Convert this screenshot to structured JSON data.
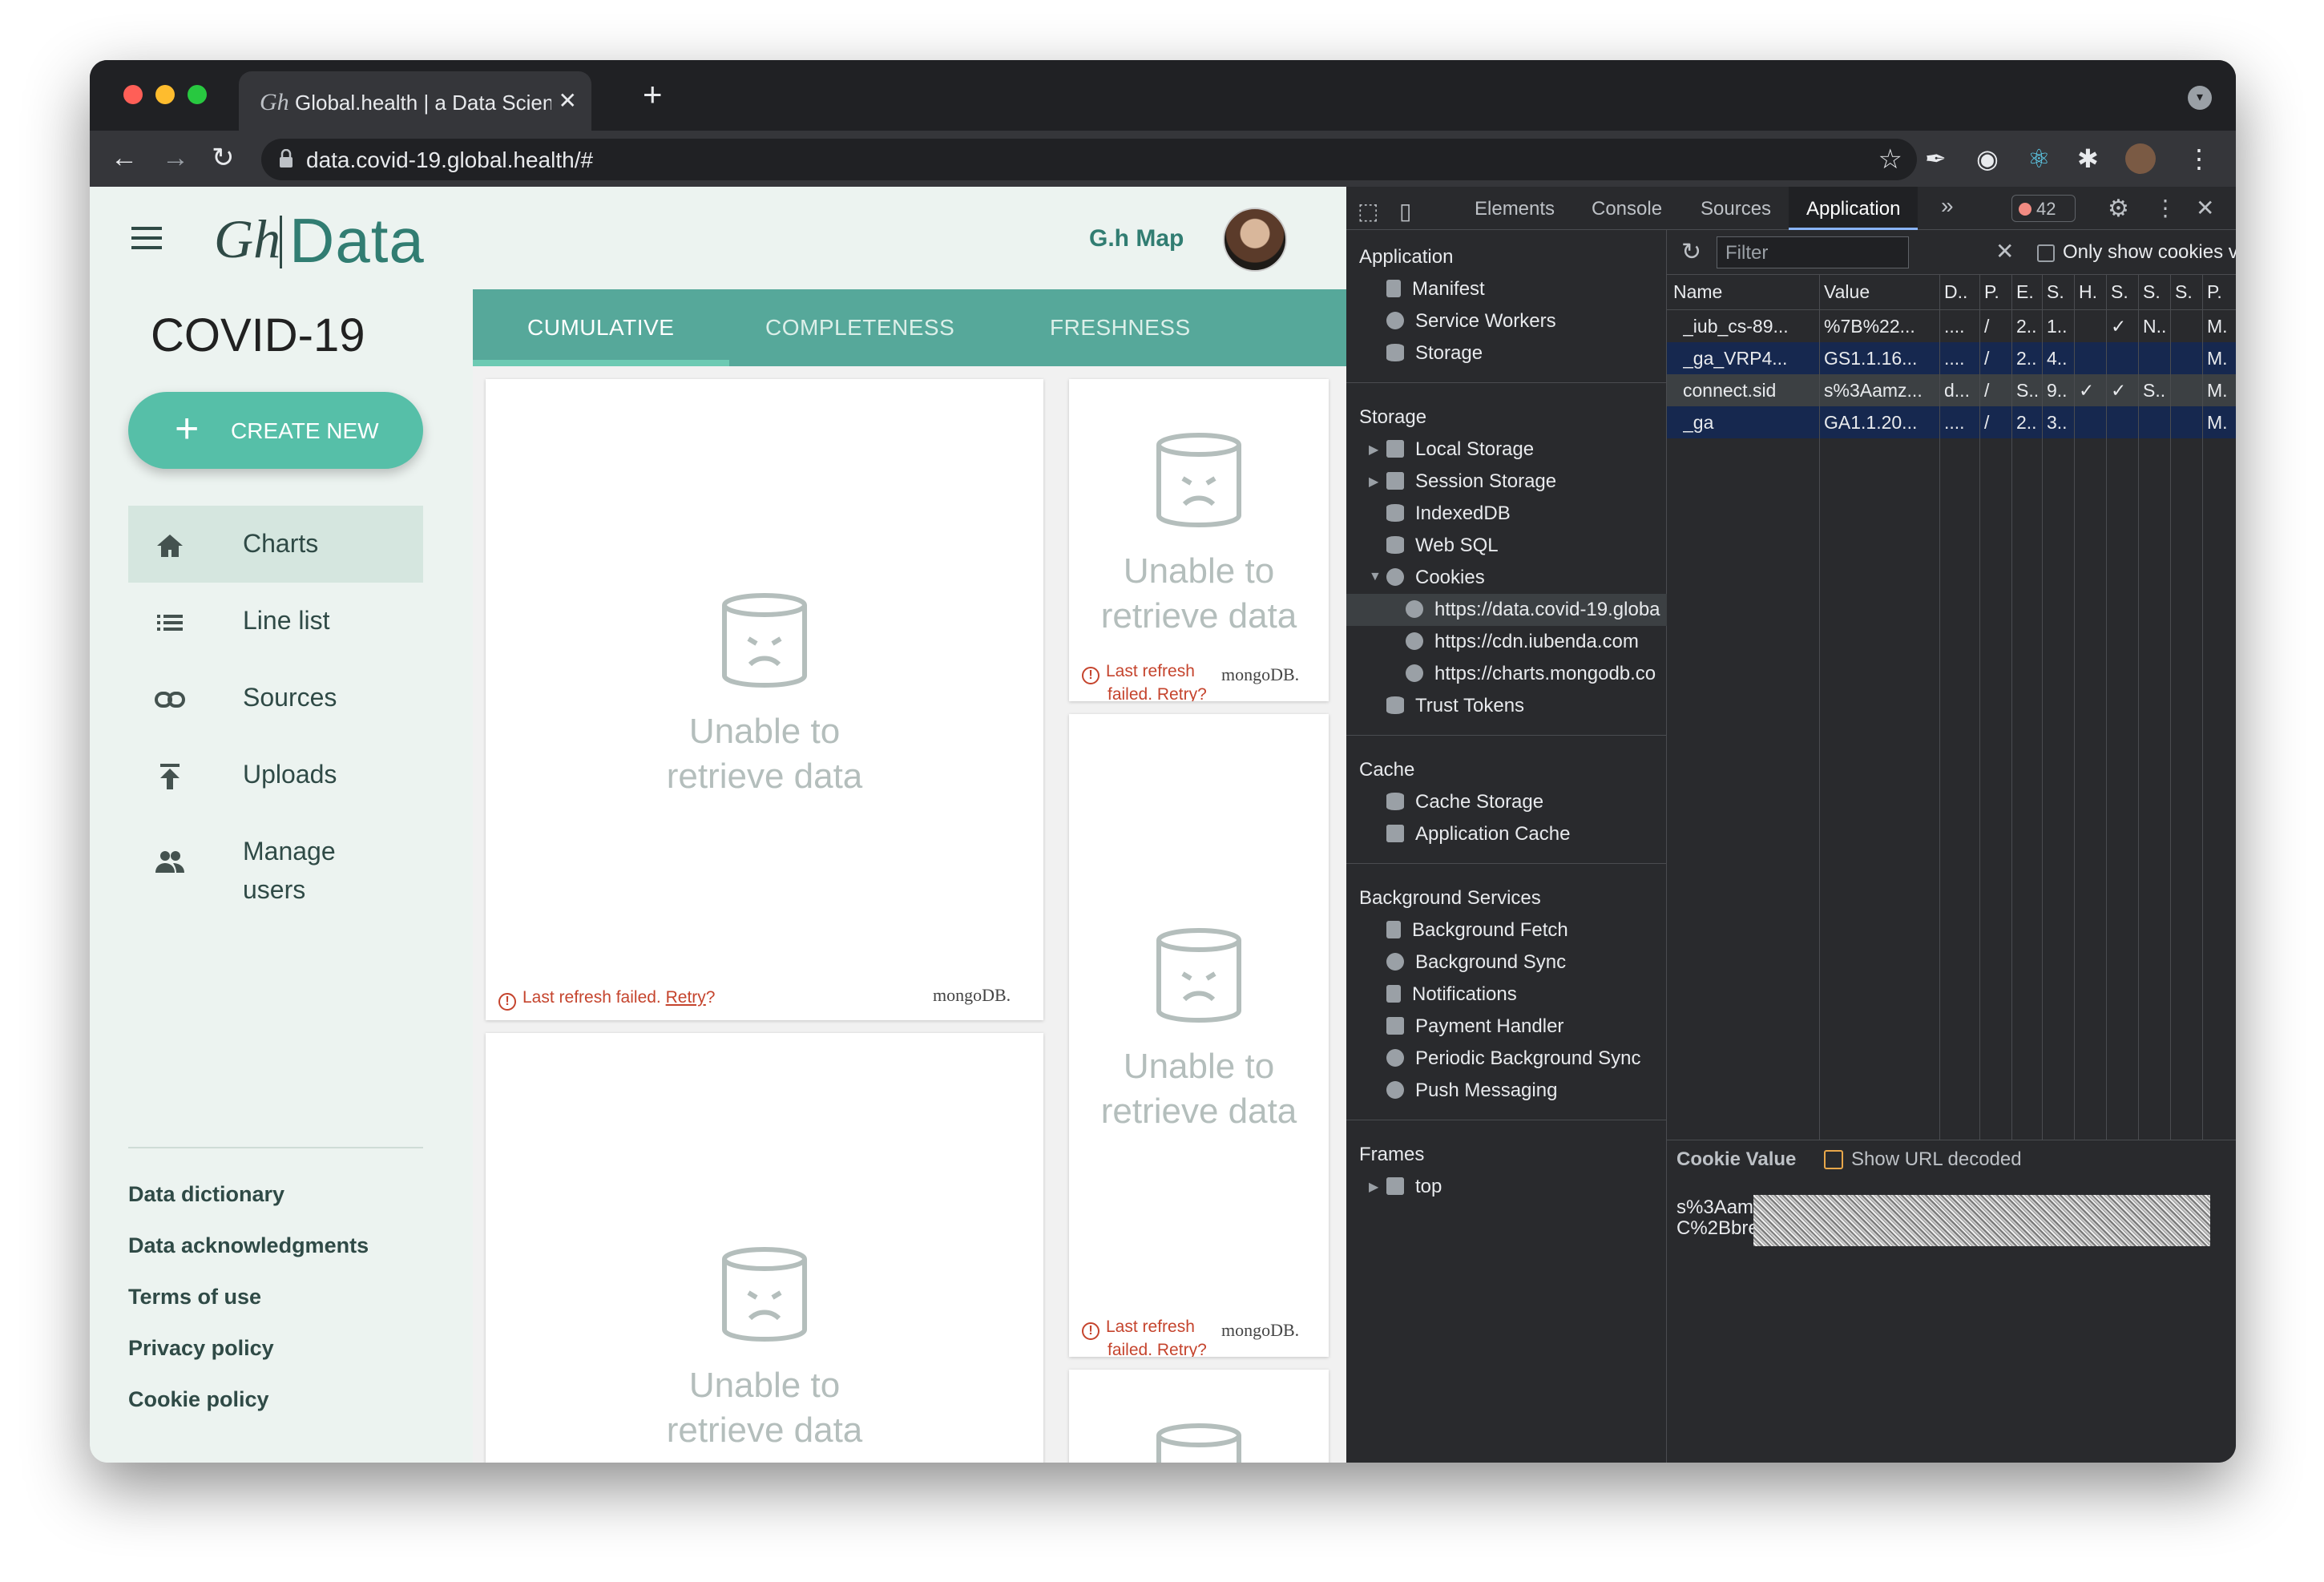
{
  "browser": {
    "tab_title": "Global.health | a Data Science I",
    "tab_logo": "Gh",
    "close_glyph": "✕",
    "new_tab_glyph": "+",
    "url": "data.covid-19.global.health/#",
    "icons": [
      "back-arrow-icon",
      "forward-arrow-icon",
      "reload-icon",
      "lock-icon",
      "star-icon",
      "puzzle-icon",
      "kebab-menu-icon"
    ]
  },
  "app": {
    "logo_gh": "Gh",
    "logo_text": "Data",
    "map_link": "G.h Map",
    "title": "COVID-19",
    "create_label": "CREATE NEW",
    "create_plus": "+",
    "nav": [
      {
        "label": "Charts",
        "icon": "home-icon",
        "active": true
      },
      {
        "label": "Line list",
        "icon": "list-icon"
      },
      {
        "label": "Sources",
        "icon": "link-icon"
      },
      {
        "label": "Uploads",
        "icon": "upload-icon"
      },
      {
        "label": "Manage",
        "label2": "users",
        "icon": "people-icon"
      }
    ],
    "footer_links": [
      "Data dictionary",
      "Data acknowledgments",
      "Terms of use",
      "Privacy policy",
      "Cookie policy"
    ],
    "chart_tabs": [
      "CUMULATIVE",
      "COMPLETENESS",
      "FRESHNESS"
    ],
    "active_tab": "CUMULATIVE",
    "card_error_line1": "Unable to",
    "card_error_line2": "retrieve data",
    "refresh_msg": "Last refresh failed.",
    "refresh_msg_a": "Last refresh",
    "refresh_msg_b": "failed.",
    "retry": "Retry",
    "retry_q": "?",
    "warn_glyph": "!",
    "brand": "mongoDB."
  },
  "devtools": {
    "tabs": [
      "Elements",
      "Console",
      "Sources",
      "Application"
    ],
    "active_tab": "Application",
    "more_glyph": "»",
    "error_count": "42",
    "sections": {
      "application": {
        "title": "Application",
        "items": [
          "Manifest",
          "Service Workers",
          "Storage"
        ]
      },
      "storage": {
        "title": "Storage",
        "items": [
          "Local Storage",
          "Session Storage",
          "IndexedDB",
          "Web SQL",
          "Cookies"
        ],
        "cookie_domains": [
          "https://data.covid-19.globa",
          "https://cdn.iubenda.com",
          "https://charts.mongodb.co"
        ],
        "after": "Trust Tokens"
      },
      "cache": {
        "title": "Cache",
        "items": [
          "Cache Storage",
          "Application Cache"
        ]
      },
      "background": {
        "title": "Background Services",
        "items": [
          "Background Fetch",
          "Background Sync",
          "Notifications",
          "Payment Handler",
          "Periodic Background Sync",
          "Push Messaging"
        ]
      },
      "frames": {
        "title": "Frames",
        "items": [
          "top"
        ]
      }
    },
    "filter_placeholder": "Filter",
    "only_show": "Only show cookies v",
    "columns": [
      "Name",
      "Value",
      "D..",
      "P.",
      "E.",
      "S.",
      "H.",
      "S.",
      "S.",
      "S.",
      "P."
    ],
    "rows": [
      [
        "_iub_cs-89...",
        "%7B%22...",
        "....",
        "/",
        "2..",
        "1..",
        "",
        "✓",
        "N..",
        "",
        "M."
      ],
      [
        "_ga_VRP4...",
        "GS1.1.16...",
        "....",
        "/",
        "2..",
        "4..",
        "",
        "",
        "",
        "",
        "M."
      ],
      [
        "connect.sid",
        "s%3Aamz...",
        "d...",
        "/",
        "S..",
        "9..",
        "✓",
        "✓",
        "S..",
        "",
        "M."
      ],
      [
        "_ga",
        "GA1.1.20...",
        "....",
        "/",
        "2..",
        "3..",
        "",
        "",
        "",
        "",
        "M."
      ]
    ],
    "selected_rows": [
      1,
      3
    ],
    "cookie_value_label": "Cookie Value",
    "show_decoded": "Show URL decoded",
    "cookie_value_1": "s%3Aam",
    "cookie_value_2": "C%2Bbre"
  }
}
